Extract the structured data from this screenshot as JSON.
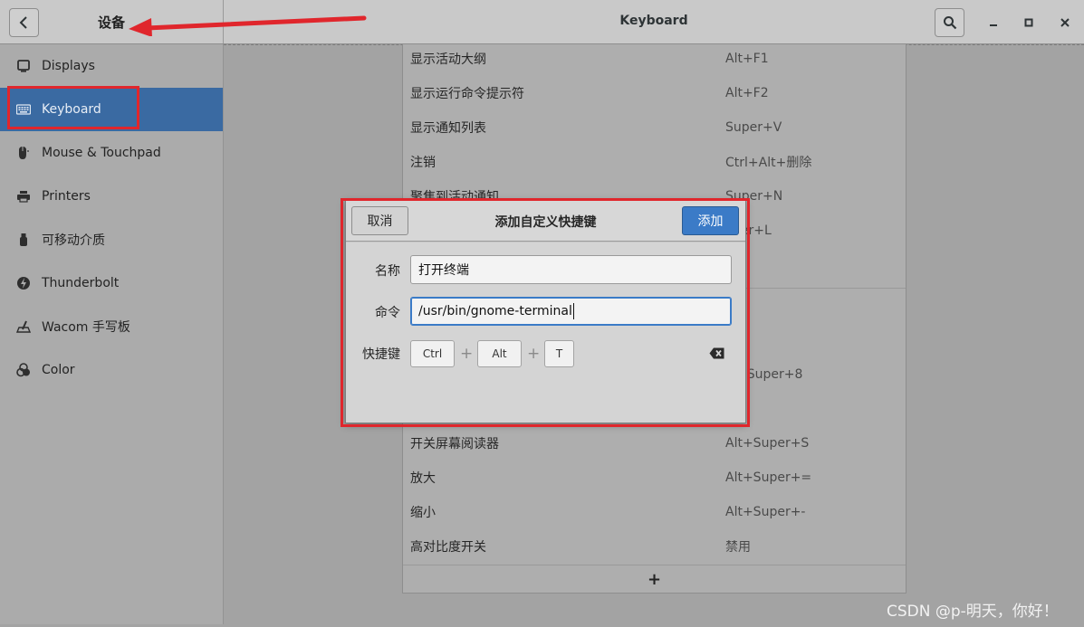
{
  "header": {
    "left_title": "设备",
    "title": "Keyboard"
  },
  "sidebar": {
    "items": [
      {
        "label": "Displays",
        "icon": "display-icon"
      },
      {
        "label": "Keyboard",
        "icon": "keyboard-icon",
        "selected": true
      },
      {
        "label": "Mouse & Touchpad",
        "icon": "mouse-icon"
      },
      {
        "label": "Printers",
        "icon": "printer-icon"
      },
      {
        "label": "可移动介质",
        "icon": "usb-drive-icon"
      },
      {
        "label": "Thunderbolt",
        "icon": "thunderbolt-icon"
      },
      {
        "label": "Wacom 手写板",
        "icon": "tablet-icon"
      },
      {
        "label": "Color",
        "icon": "color-icon"
      }
    ]
  },
  "shortcuts": {
    "rows": [
      {
        "name": "显示活动大纲",
        "accel": "Alt+F1"
      },
      {
        "name": "显示运行命令提示符",
        "accel": "Alt+F2"
      },
      {
        "name": "显示通知列表",
        "accel": "Super+V"
      },
      {
        "name": "注销",
        "accel": "Ctrl+Alt+删除"
      },
      {
        "name": "聚焦到活动通知",
        "accel": "Super+N"
      },
      {
        "name": "",
        "accel": "per+L"
      },
      {
        "name": "",
        "accel": "+Super+8"
      },
      {
        "name": "开关屏幕阅读器",
        "accel": "Alt+Super+S"
      },
      {
        "name": "放大",
        "accel": "Alt+Super+="
      },
      {
        "name": "缩小",
        "accel": "Alt+Super+-"
      },
      {
        "name": "高对比度开关",
        "accel": "禁用"
      }
    ],
    "add_label": "+"
  },
  "dialog": {
    "title": "添加自定义快捷键",
    "cancel_label": "取消",
    "add_label": "添加",
    "name_label": "名称",
    "name_value": "打开终端",
    "command_label": "命令",
    "command_value": "/usr/bin/gnome-terminal",
    "shortcut_label": "快捷键",
    "keys": [
      "Ctrl",
      "Alt",
      "T"
    ],
    "plus": "+"
  },
  "watermark": "CSDN @p-明天，你好！",
  "colors": {
    "accent": "#3b7bc7",
    "selected_sidebar": "#3a6aa2",
    "annotation_red": "#e0262c"
  }
}
